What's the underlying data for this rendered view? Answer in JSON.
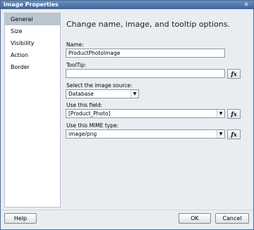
{
  "window": {
    "title": "Image Properties",
    "close_glyph": "✕"
  },
  "sidebar": {
    "items": [
      {
        "label": "General"
      },
      {
        "label": "Size"
      },
      {
        "label": "Visibility"
      },
      {
        "label": "Action"
      },
      {
        "label": "Border"
      }
    ]
  },
  "main": {
    "heading": "Change name, image, and tooltip options.",
    "name_label": "Name:",
    "name_value": "ProductPhotoImage",
    "tooltip_label": "ToolTip:",
    "tooltip_value": "",
    "source_label": "Select the image source:",
    "source_value": "Database",
    "field_label": "Use this field:",
    "field_value": "[Product_Photo]",
    "mime_label": "Use this MIME type:",
    "mime_value": "image/png",
    "fx_glyph": "fx",
    "dropdown_glyph": "▼"
  },
  "buttons": {
    "help": "Help",
    "ok": "OK",
    "cancel": "Cancel"
  }
}
